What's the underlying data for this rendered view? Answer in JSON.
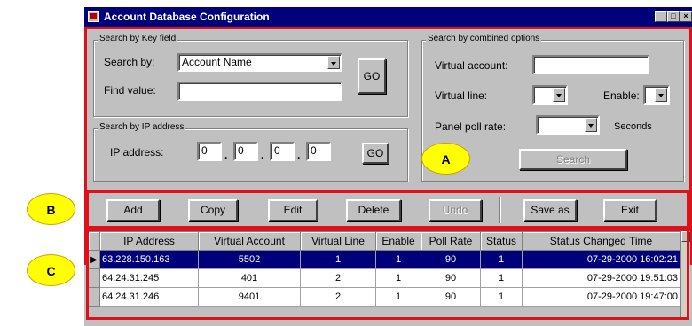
{
  "window": {
    "title": "Account Database Configuration",
    "buttons": [
      "_",
      "□",
      "×"
    ]
  },
  "search_key": {
    "group_label": "Search by Key field",
    "search_by_label": "Search by:",
    "search_by_value": "Account Name",
    "find_value_label": "Find value:",
    "find_value": "",
    "go_label": "GO"
  },
  "search_ip": {
    "group_label": "Search by IP address",
    "ip_label": "IP address:",
    "octets": [
      "0",
      "0",
      "0",
      "0"
    ],
    "go_label": "GO"
  },
  "search_combined": {
    "group_label": "Search by combined options",
    "virtual_account_label": "Virtual account:",
    "virtual_account_value": "",
    "virtual_line_label": "Virtual line:",
    "enable_label": "Enable:",
    "poll_rate_label": "Panel poll rate:",
    "seconds_label": "Seconds",
    "search_label": "Search"
  },
  "toolbar": {
    "add": "Add",
    "copy": "Copy",
    "edit": "Edit",
    "delete": "Delete",
    "undo": "Undo",
    "save_as": "Save as",
    "exit": "Exit"
  },
  "callouts": {
    "a": "A",
    "b": "B",
    "c": "C"
  },
  "table": {
    "columns": [
      "IP Address",
      "Virtual Account",
      "Virtual Line",
      "Enable",
      "Poll Rate",
      "Status",
      "Status Changed Time"
    ],
    "rows": [
      [
        "63.228.150.163",
        "5502",
        "1",
        "1",
        "90",
        "1",
        "07-29-2000 16:02:21"
      ],
      [
        "64.24.31.245",
        "401",
        "2",
        "1",
        "90",
        "1",
        "07-29-2000 19:51:03"
      ],
      [
        "64.24.31.246",
        "9401",
        "2",
        "1",
        "90",
        "1",
        "07-29-2000 19:47:00"
      ]
    ]
  },
  "colors": {
    "highlight": "#e0101a",
    "selection": "#00007b",
    "callout": "#ffff00"
  }
}
